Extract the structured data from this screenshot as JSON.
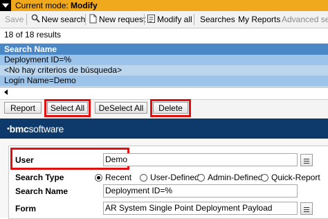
{
  "mode_bar": {
    "label": "Current mode:",
    "mode": "Modify"
  },
  "toolbar": {
    "save": "Save",
    "new_search": "New search",
    "new_request": "New request",
    "modify_all": "Modify all",
    "searches": "Searches",
    "my_reports": "My Reports",
    "advanced_search": "Advanced sea"
  },
  "results": {
    "count": "18 of 18 results",
    "column_header": "Search Name",
    "rows": [
      "Deployment ID=%",
      "<No hay criterios de búsqueda>",
      "Login Name=Demo"
    ]
  },
  "buttons": {
    "report": "Report",
    "select_all": "Select All",
    "deselect_all": "DeSelect All",
    "delete": "Delete"
  },
  "brand": {
    "prefix": "bmc",
    "suffix": "software"
  },
  "form": {
    "user_label": "User",
    "user_value": "Demo",
    "search_type_label": "Search Type",
    "search_type_options": [
      "Recent",
      "User-Defined",
      "Admin-Defined",
      "Quick-Report"
    ],
    "search_type_selected": "Recent",
    "search_name_label": "Search Name",
    "search_name_value": "Deployment ID=%",
    "form_label": "Form",
    "form_value": "AR System Single Point Deployment Payload"
  },
  "colors": {
    "mode_bar": "#f0a81c",
    "results_header": "#4a87c7",
    "results_rows": "#bcd6ee",
    "brand_bar": "#0d3a6b",
    "highlight_box": "#e01010"
  }
}
